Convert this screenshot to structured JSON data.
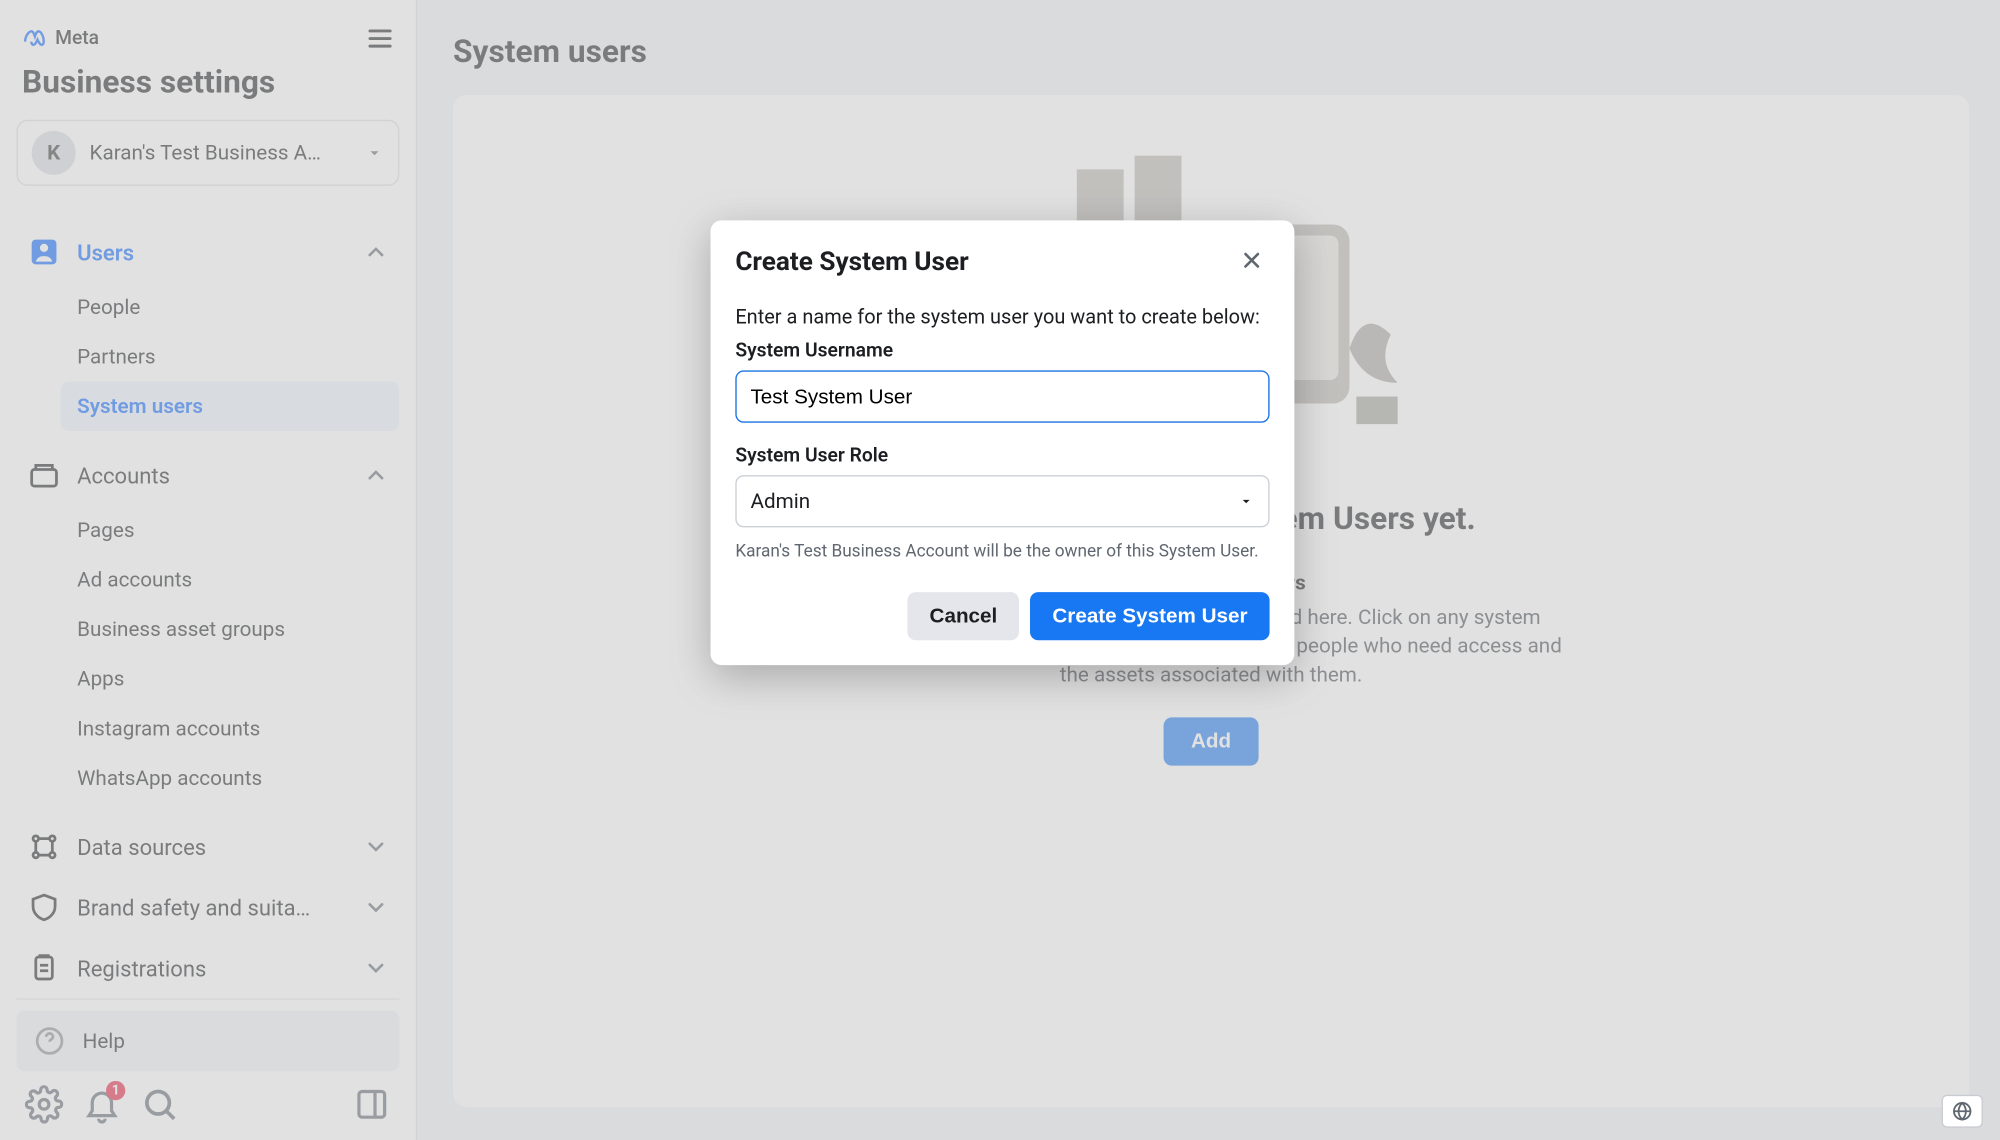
{
  "brand": {
    "name": "Meta"
  },
  "sidebar": {
    "title": "Business settings",
    "account": {
      "avatar_initial": "K",
      "name": "Karan's Test Business A…"
    },
    "sections": [
      {
        "id": "users",
        "label": "Users",
        "expanded": true,
        "items": [
          {
            "label": "People"
          },
          {
            "label": "Partners"
          },
          {
            "label": "System users",
            "active": true
          }
        ]
      },
      {
        "id": "accounts",
        "label": "Accounts",
        "expanded": true,
        "items": [
          {
            "label": "Pages"
          },
          {
            "label": "Ad accounts"
          },
          {
            "label": "Business asset groups"
          },
          {
            "label": "Apps"
          },
          {
            "label": "Instagram accounts"
          },
          {
            "label": "WhatsApp accounts"
          }
        ]
      },
      {
        "id": "data_sources",
        "label": "Data sources",
        "expanded": false
      },
      {
        "id": "brand_safety",
        "label": "Brand safety and suitabil…",
        "expanded": false
      },
      {
        "id": "registrations",
        "label": "Registrations",
        "expanded": false
      }
    ],
    "help_label": "Help",
    "notification_badge": "1"
  },
  "main": {
    "title": "System users",
    "empty_heading": "You don't have any System Users yet.",
    "empty_subtitle": "About System Users",
    "empty_description": "All system users in this business can be listed here. Click on any system user to see more details. Then, you can add the people who need access and the assets associated with them.",
    "add_button": "Add"
  },
  "modal": {
    "title": "Create System User",
    "instruction": "Enter a name for the system user you want to create below:",
    "username_label": "System Username",
    "username_value": "Test System User",
    "role_label": "System User Role",
    "role_value": "Admin",
    "helper": "Karan's Test Business Account will be the owner of this System User.",
    "cancel_label": "Cancel",
    "submit_label": "Create System User"
  }
}
